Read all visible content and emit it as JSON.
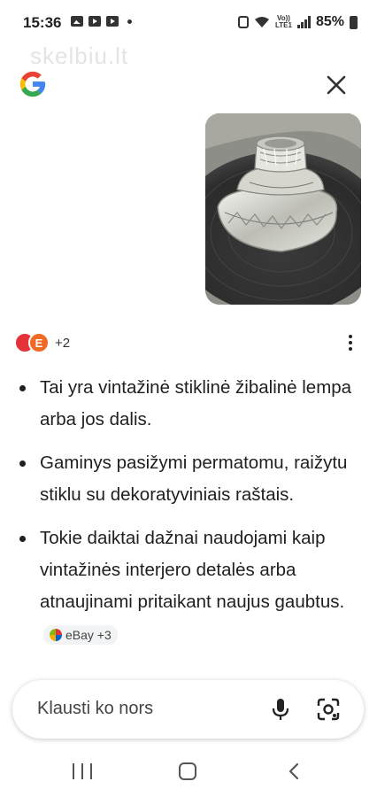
{
  "status_bar": {
    "time": "15:36",
    "volte_top": "Vo))",
    "volte_bottom": "LTE1",
    "battery": "85%"
  },
  "watermark": "skelbiu.lt",
  "header": {
    "logo": "google-logo",
    "close_icon": "close-icon"
  },
  "image": {
    "subject": "photo"
  },
  "sources": {
    "count": "+2",
    "icons": [
      "ebay-icon",
      "e-brand-icon"
    ],
    "e_letter": "E"
  },
  "bullets": [
    {
      "text": "Tai yra vintažinė stiklinė žibalinė lempa arba jos dalis."
    },
    {
      "text": "Gaminys pasižymi permatomu, raižytu stiklu su dekoratyviniais raštais."
    },
    {
      "text": "Tokie daiktai dažnai naudojami kaip vintažinės interjero detalės arba atnaujinami pritaikant naujus gaubtus.",
      "chip": "eBay +3"
    }
  ],
  "ask_bar": {
    "placeholder": "Klausti ko nors"
  },
  "colors": {
    "accent_blue": "#4285F4",
    "accent_red": "#EA4335",
    "accent_yellow": "#FBBC05",
    "accent_green": "#34A853"
  }
}
